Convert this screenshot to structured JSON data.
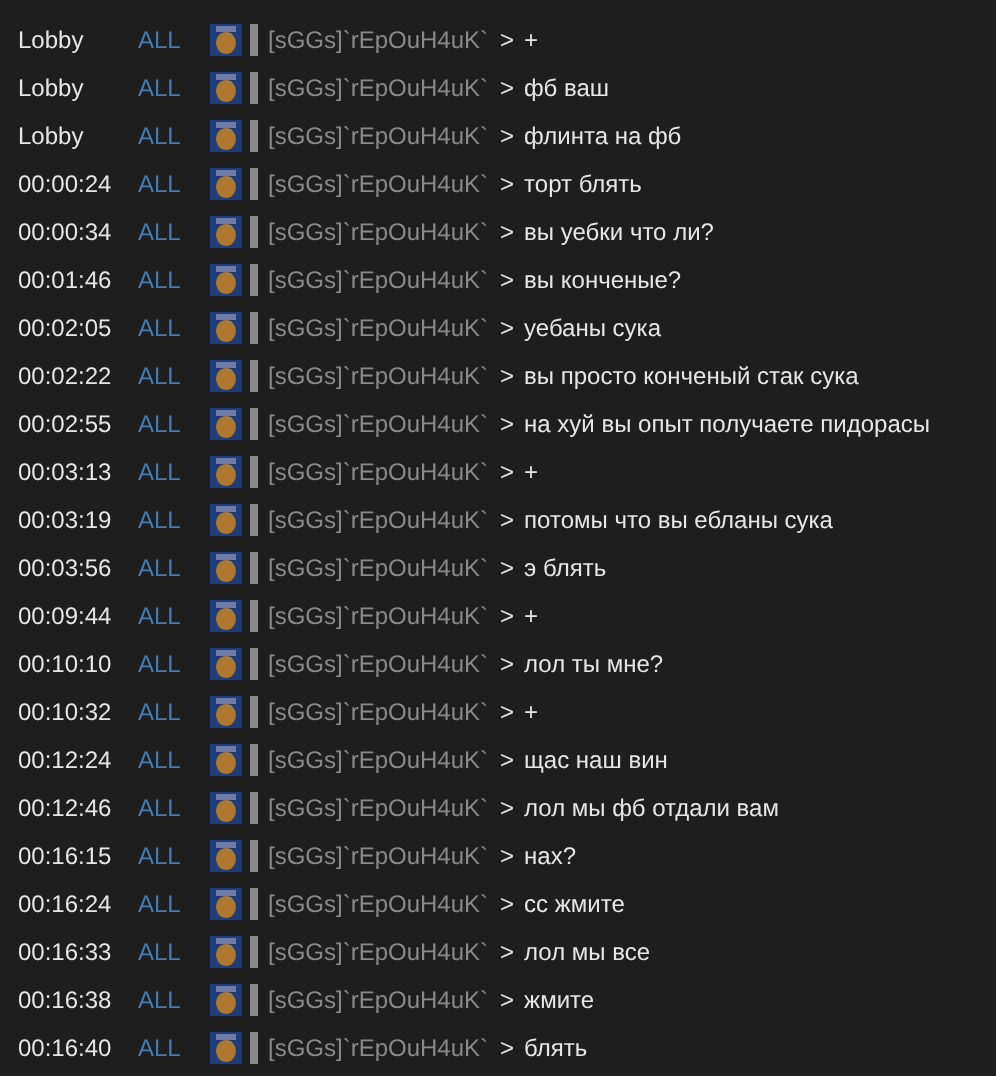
{
  "messages": [
    {
      "time": "Lobby",
      "channel": "ALL",
      "player": "[sGGs]`rEpOuH4uK`",
      "separator": ">",
      "text": "+"
    },
    {
      "time": "Lobby",
      "channel": "ALL",
      "player": "[sGGs]`rEpOuH4uK`",
      "separator": ">",
      "text": "фб ваш"
    },
    {
      "time": "Lobby",
      "channel": "ALL",
      "player": "[sGGs]`rEpOuH4uK`",
      "separator": ">",
      "text": "флинта на фб"
    },
    {
      "time": "00:00:24",
      "channel": "ALL",
      "player": "[sGGs]`rEpOuH4uK`",
      "separator": ">",
      "text": "торт блять"
    },
    {
      "time": "00:00:34",
      "channel": "ALL",
      "player": "[sGGs]`rEpOuH4uK`",
      "separator": ">",
      "text": "вы уебки что ли?"
    },
    {
      "time": "00:01:46",
      "channel": "ALL",
      "player": "[sGGs]`rEpOuH4uK`",
      "separator": ">",
      "text": "вы конченые?"
    },
    {
      "time": "00:02:05",
      "channel": "ALL",
      "player": "[sGGs]`rEpOuH4uK`",
      "separator": ">",
      "text": "уебаны сука"
    },
    {
      "time": "00:02:22",
      "channel": "ALL",
      "player": "[sGGs]`rEpOuH4uK`",
      "separator": ">",
      "text": "вы просто конченый стак сука"
    },
    {
      "time": "00:02:55",
      "channel": "ALL",
      "player": "[sGGs]`rEpOuH4uK`",
      "separator": ">",
      "text": "на хуй вы опыт получаете пидорасы"
    },
    {
      "time": "00:03:13",
      "channel": "ALL",
      "player": "[sGGs]`rEpOuH4uK`",
      "separator": ">",
      "text": "+"
    },
    {
      "time": "00:03:19",
      "channel": "ALL",
      "player": "[sGGs]`rEpOuH4uK`",
      "separator": ">",
      "text": "потомы что вы ебланы сука"
    },
    {
      "time": "00:03:56",
      "channel": "ALL",
      "player": "[sGGs]`rEpOuH4uK`",
      "separator": ">",
      "text": "э блять"
    },
    {
      "time": "00:09:44",
      "channel": "ALL",
      "player": "[sGGs]`rEpOuH4uK`",
      "separator": ">",
      "text": "+"
    },
    {
      "time": "00:10:10",
      "channel": "ALL",
      "player": "[sGGs]`rEpOuH4uK`",
      "separator": ">",
      "text": "лол ты мне?"
    },
    {
      "time": "00:10:32",
      "channel": "ALL",
      "player": "[sGGs]`rEpOuH4uK`",
      "separator": ">",
      "text": "+"
    },
    {
      "time": "00:12:24",
      "channel": "ALL",
      "player": "[sGGs]`rEpOuH4uK`",
      "separator": ">",
      "text": "щас наш вин"
    },
    {
      "time": "00:12:46",
      "channel": "ALL",
      "player": "[sGGs]`rEpOuH4uK`",
      "separator": ">",
      "text": "лол мы фб отдали вам"
    },
    {
      "time": "00:16:15",
      "channel": "ALL",
      "player": "[sGGs]`rEpOuH4uK`",
      "separator": ">",
      "text": "нах?"
    },
    {
      "time": "00:16:24",
      "channel": "ALL",
      "player": "[sGGs]`rEpOuH4uK`",
      "separator": ">",
      "text": "сс жмите"
    },
    {
      "time": "00:16:33",
      "channel": "ALL",
      "player": "[sGGs]`rEpOuH4uK`",
      "separator": ">",
      "text": "лол мы все"
    },
    {
      "time": "00:16:38",
      "channel": "ALL",
      "player": "[sGGs]`rEpOuH4uK`",
      "separator": ">",
      "text": "жмите"
    },
    {
      "time": "00:16:40",
      "channel": "ALL",
      "player": "[sGGs]`rEpOuH4uK`",
      "separator": ">",
      "text": "блять"
    }
  ]
}
